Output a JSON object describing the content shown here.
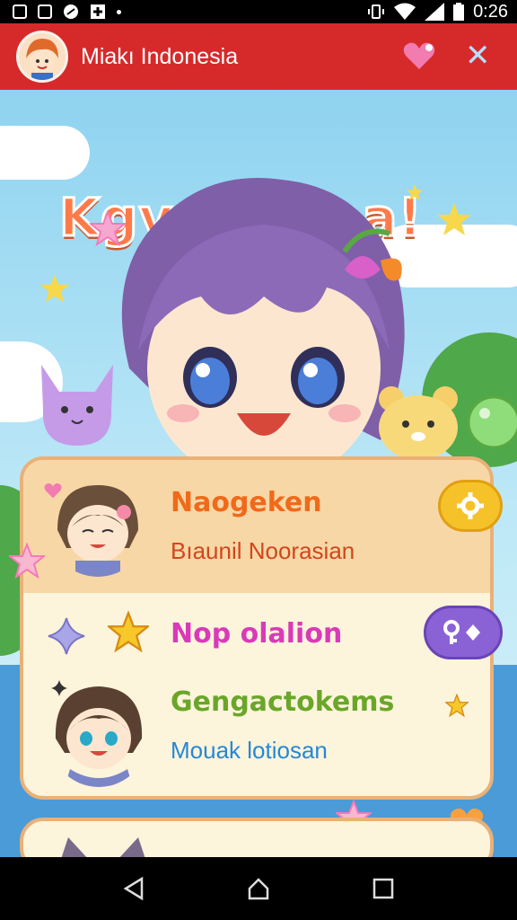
{
  "status_bar": {
    "time": "0:26",
    "left_icons": [
      "sim-icon",
      "sd-card-icon",
      "sync-icon",
      "plus-box-icon",
      "dot-icon"
    ],
    "right_icons": [
      "vibrate-icon",
      "wifi-icon",
      "signal-icon",
      "battery-icon"
    ]
  },
  "app_bar": {
    "title": "Miakı Indonesia",
    "heart_icon": "heart-icon",
    "close_icon": "close-icon",
    "color": "#d62a2a"
  },
  "game": {
    "title": "Kgve Baina!"
  },
  "rows": [
    {
      "title": "Naogeken",
      "subtitle": "Bıaunil Noorasian",
      "title_color": "#f06a1a",
      "subtitle_color": "#d2461c",
      "button_icon": "gear-icon",
      "button_color": "#f6c22a"
    },
    {
      "title": "Nop olalion",
      "title_color": "#d93ab8",
      "button_icon": "key-icon",
      "button_color": "#8b62d6"
    },
    {
      "title": "Gengactokems",
      "subtitle": "Mouak lotiosan",
      "title_color": "#6aa62a",
      "subtitle_color": "#2688d6"
    }
  ],
  "nav": {
    "back_icon": "back-icon",
    "home_icon": "home-icon",
    "recents_icon": "recents-icon"
  }
}
